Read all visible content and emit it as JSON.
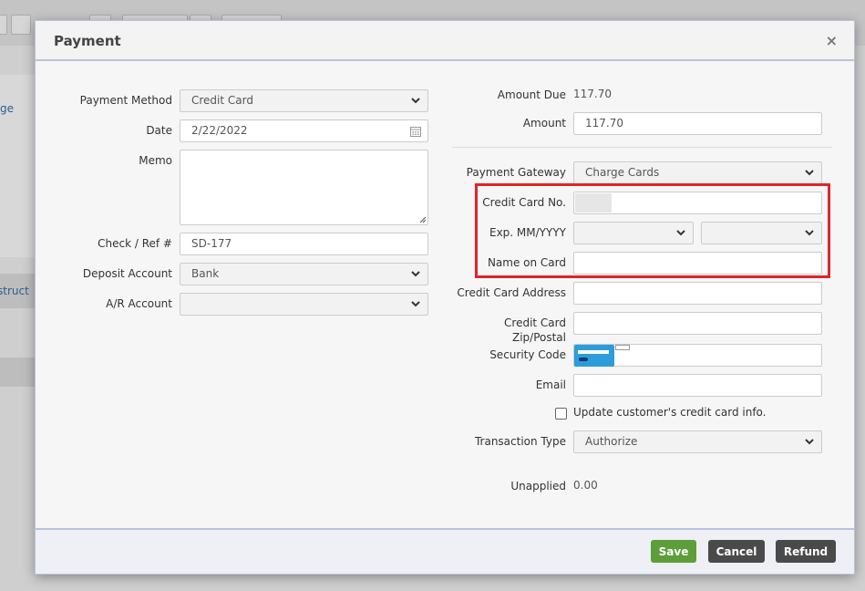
{
  "background": {
    "left_text_1": "ge",
    "left_text_2": "struct"
  },
  "modal": {
    "title": "Payment",
    "close_glyph": "×"
  },
  "left_form": {
    "payment_method": {
      "label": "Payment Method",
      "value": "Credit Card"
    },
    "date": {
      "label": "Date",
      "value": "2/22/2022"
    },
    "memo": {
      "label": "Memo",
      "value": ""
    },
    "check_ref": {
      "label": "Check / Ref #",
      "value": "SD-177"
    },
    "deposit_account": {
      "label": "Deposit Account",
      "value": "Bank"
    },
    "ar_account": {
      "label": "A/R Account",
      "value": ""
    }
  },
  "right_form": {
    "amount_due": {
      "label": "Amount Due",
      "value": "117.70"
    },
    "amount": {
      "label": "Amount",
      "value": "117.70"
    },
    "payment_gateway": {
      "label": "Payment Gateway",
      "value": "Charge Cards"
    },
    "credit_card_no": {
      "label": "Credit Card No.",
      "value": ""
    },
    "exp": {
      "label": "Exp. MM/YYYY",
      "month": "",
      "year": ""
    },
    "name_on_card": {
      "label": "Name on Card",
      "value": ""
    },
    "cc_address": {
      "label": "Credit Card Address",
      "value": ""
    },
    "cc_zip": {
      "label_line1": "Credit Card",
      "label_line2": "Zip/Postal",
      "value": ""
    },
    "security_code": {
      "label": "Security Code",
      "value": ""
    },
    "email": {
      "label": "Email",
      "value": ""
    },
    "update_info": {
      "label": "Update customer's credit card info.",
      "checked": false
    },
    "transaction_type": {
      "label": "Transaction Type",
      "value": "Authorize"
    },
    "unapplied": {
      "label": "Unapplied",
      "value": "0.00"
    }
  },
  "footer": {
    "save": "Save",
    "cancel": "Cancel",
    "refund": "Refund"
  },
  "colors": {
    "save": "#5d9d3a",
    "dark_button": "#4a4a4a",
    "highlight": "#e0242b",
    "card_icon": "#2d9cdb"
  }
}
